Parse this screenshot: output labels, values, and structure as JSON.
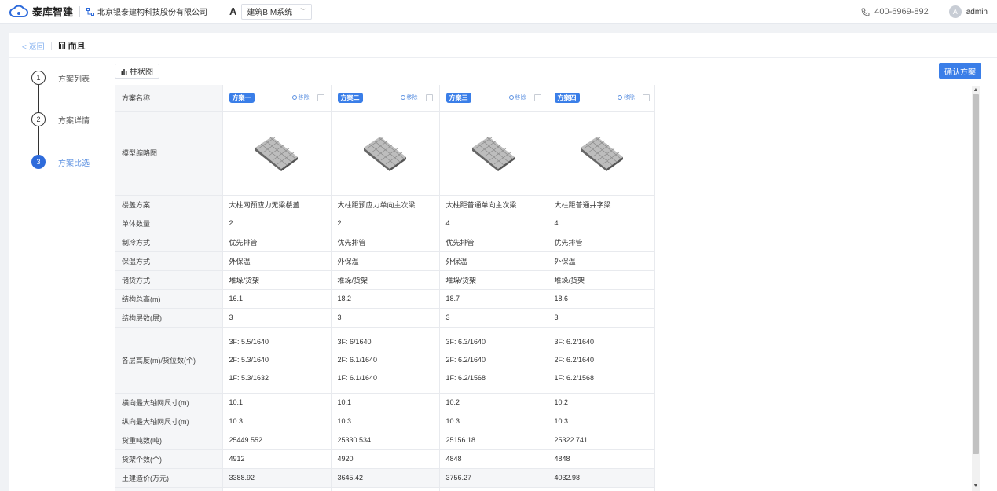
{
  "brand": {
    "name": "泰库智建",
    "company": "北京银泰建构科技股份有限公司",
    "system_letter": "A",
    "system": "建筑BIM系统"
  },
  "header": {
    "phone": "400-6969-892",
    "avatar_letter": "A",
    "user": "admin"
  },
  "breadcrumb": {
    "back": "< 返回",
    "title": "而且"
  },
  "steps": [
    {
      "num": "1",
      "label": "方案列表"
    },
    {
      "num": "2",
      "label": "方案详情"
    },
    {
      "num": "3",
      "label": "方案比选"
    }
  ],
  "toolbar": {
    "bar_chart": "柱状图",
    "confirm": "确认方案"
  },
  "table": {
    "name_label": "方案名称",
    "thumb_label": "模型缩略图",
    "remove_label": "移除",
    "schemes": [
      "方案一",
      "方案二",
      "方案三",
      "方案四"
    ],
    "rows": [
      {
        "label": "楼盖方案",
        "values": [
          "大柱网预应力无梁楼盖",
          "大柱距预应力单向主次梁",
          "大柱距普通单向主次梁",
          "大柱距普通井字梁"
        ]
      },
      {
        "label": "单体数量",
        "values": [
          "2",
          "2",
          "4",
          "4"
        ]
      },
      {
        "label": "制冷方式",
        "values": [
          "优先排管",
          "优先排管",
          "优先排管",
          "优先排管"
        ]
      },
      {
        "label": "保温方式",
        "values": [
          "外保温",
          "外保温",
          "外保温",
          "外保温"
        ]
      },
      {
        "label": "储货方式",
        "values": [
          "堆垛/货架",
          "堆垛/货架",
          "堆垛/货架",
          "堆垛/货架"
        ]
      },
      {
        "label": "结构总高(m)",
        "values": [
          "16.1",
          "18.2",
          "18.7",
          "18.6"
        ]
      },
      {
        "label": "结构层数(层)",
        "values": [
          "3",
          "3",
          "3",
          "3"
        ]
      }
    ],
    "floors": {
      "label": "各层高度(m)/货位数(个)",
      "values": [
        [
          "3F: 5.5/1640",
          "2F: 5.3/1640",
          "1F: 5.3/1632"
        ],
        [
          "3F: 6/1640",
          "2F: 6.1/1640",
          "1F: 6.1/1640"
        ],
        [
          "3F: 6.3/1640",
          "2F: 6.2/1640",
          "1F: 6.2/1568"
        ],
        [
          "3F: 6.2/1640",
          "2F: 6.2/1640",
          "1F: 6.2/1568"
        ]
      ]
    },
    "rows2": [
      {
        "label": "横向最大轴网尺寸(m)",
        "values": [
          "10.1",
          "10.1",
          "10.2",
          "10.2"
        ]
      },
      {
        "label": "纵向最大轴网尺寸(m)",
        "values": [
          "10.3",
          "10.3",
          "10.3",
          "10.3"
        ]
      },
      {
        "label": "货重吨数(吨)",
        "values": [
          "25449.552",
          "25330.534",
          "25156.18",
          "25322.741"
        ]
      },
      {
        "label": "货架个数(个)",
        "values": [
          "4912",
          "4920",
          "4848",
          "4848"
        ]
      },
      {
        "label": "土建造价(万元)",
        "values": [
          "3388.92",
          "3645.42",
          "3756.27",
          "4032.98"
        ]
      }
    ]
  }
}
